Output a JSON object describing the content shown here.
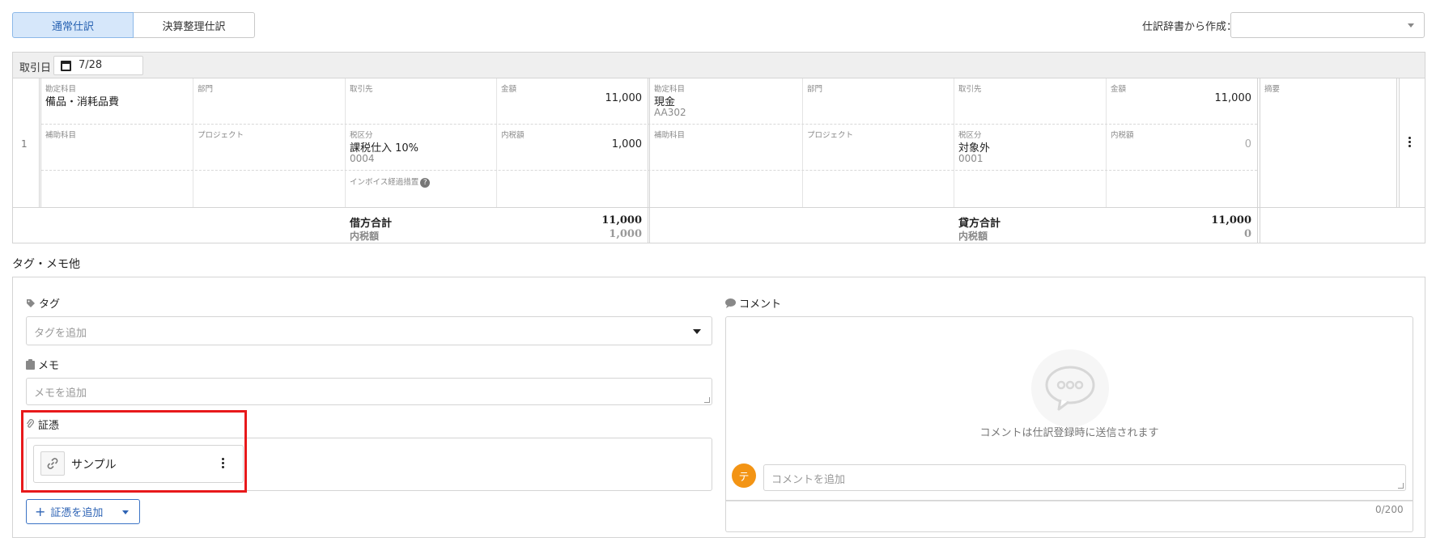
{
  "tabs": [
    {
      "label": "通常仕訳",
      "active": true
    },
    {
      "label": "決算整理仕訳",
      "active": false
    }
  ],
  "dictionary": {
    "label": "仕訳辞書から作成：",
    "value": ""
  },
  "journal": {
    "date_label": "取引日",
    "date_value": "7/28",
    "row_number": "1",
    "debit": {
      "account_label": "勘定科目",
      "account": "備品・消耗品費",
      "department_label": "部門",
      "partner_label": "取引先",
      "amount_label": "金額",
      "amount": "11,000",
      "sub_account_label": "補助科目",
      "project_label": "プロジェクト",
      "tax_label": "税区分",
      "tax": "課税仕入 10%",
      "tax_code": "0004",
      "tax_amount_label": "内税額",
      "tax_amount": "1,000",
      "invoice_label": "インボイス経過措置"
    },
    "credit": {
      "account_label": "勘定科目",
      "account": "現金",
      "account_code": "AA302",
      "department_label": "部門",
      "partner_label": "取引先",
      "amount_label": "金額",
      "amount": "11,000",
      "sub_account_label": "補助科目",
      "project_label": "プロジェクト",
      "tax_label": "税区分",
      "tax": "対象外",
      "tax_code": "0001",
      "tax_amount_label": "内税額",
      "tax_amount": "0"
    },
    "summary_label": "摘要",
    "totals": {
      "debit_label": "借方合計",
      "debit_total": "11,000",
      "debit_tax_label": "内税額",
      "debit_tax": "1,000",
      "credit_label": "貸方合計",
      "credit_total": "11,000",
      "credit_tax_label": "内税額",
      "credit_tax": "0"
    }
  },
  "section": {
    "title": "タグ・メモ他",
    "tag_label": "タグ",
    "tag_placeholder": "タグを追加",
    "memo_label": "メモ",
    "memo_placeholder": "メモを追加",
    "evidence_label": "証憑",
    "evidence_items": [
      {
        "name": "サンプル"
      }
    ],
    "add_evidence": "証憑を追加",
    "comment_label": "コメント",
    "comment_empty": "コメントは仕訳登録時に送信されます",
    "comment_placeholder": "コメントを追加",
    "avatar_initial": "テ",
    "comment_counter": "0/200"
  },
  "colors": {
    "accent": "#2f64b5",
    "highlight": "#e8191b",
    "avatar": "#f39414"
  }
}
